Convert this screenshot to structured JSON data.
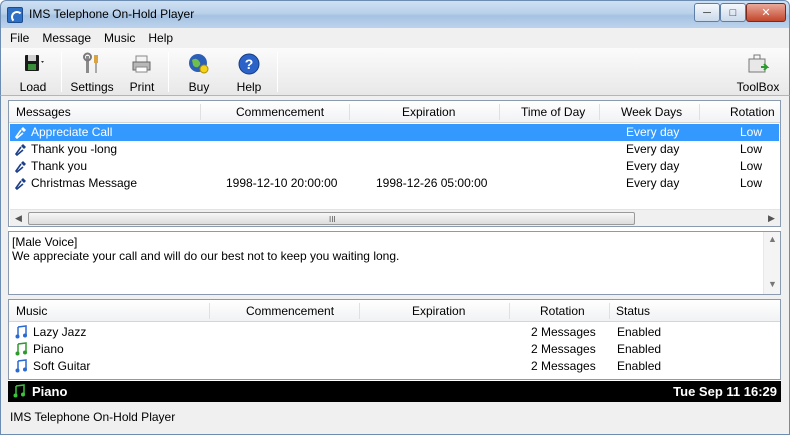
{
  "window": {
    "title": "IMS Telephone On-Hold Player"
  },
  "menu": [
    "File",
    "Message",
    "Music",
    "Help"
  ],
  "toolbar": {
    "load": "Load",
    "settings": "Settings",
    "print": "Print",
    "buy": "Buy",
    "help": "Help",
    "toolbox": "ToolBox"
  },
  "messages": {
    "headers": [
      "Messages",
      "Commencement",
      "Expiration",
      "Time of Day",
      "Week Days",
      "Rotation"
    ],
    "rows": [
      {
        "name": "Appreciate Call",
        "commencement": "",
        "expiration": "",
        "time": "",
        "days": "Every day",
        "rotation": "Low",
        "selected": true
      },
      {
        "name": "Thank you -long",
        "commencement": "",
        "expiration": "",
        "time": "",
        "days": "Every day",
        "rotation": "Low",
        "selected": false
      },
      {
        "name": "Thank you",
        "commencement": "",
        "expiration": "",
        "time": "",
        "days": "Every day",
        "rotation": "Low",
        "selected": false
      },
      {
        "name": "Christmas Message",
        "commencement": "1998-12-10 20:00:00",
        "expiration": "1998-12-26 05:00:00",
        "time": "",
        "days": "Every day",
        "rotation": "Low",
        "selected": false
      }
    ],
    "scroll_grip": "III"
  },
  "description": {
    "line1": "[Male Voice]",
    "line2": "We appreciate your call and will do our best not to keep you waiting long."
  },
  "music": {
    "headers": [
      "Music",
      "Commencement",
      "Expiration",
      "Rotation",
      "Status"
    ],
    "rows": [
      {
        "name": "Lazy Jazz",
        "rotation": "2 Messages",
        "status": "Enabled",
        "playing": false
      },
      {
        "name": "Piano",
        "rotation": "2 Messages",
        "status": "Enabled",
        "playing": true
      },
      {
        "name": "Soft Guitar",
        "rotation": "2 Messages",
        "status": "Enabled",
        "playing": false
      }
    ]
  },
  "now_playing": {
    "track": "Piano",
    "datetime": "Tue Sep 11 16:29"
  },
  "statusbar": {
    "text": "IMS Telephone On-Hold Player"
  },
  "colors": {
    "selection": "#3399ff",
    "now_playing_bg": "#000000",
    "note_blue": "#2a6ad0",
    "note_green": "#2e9a2e"
  }
}
